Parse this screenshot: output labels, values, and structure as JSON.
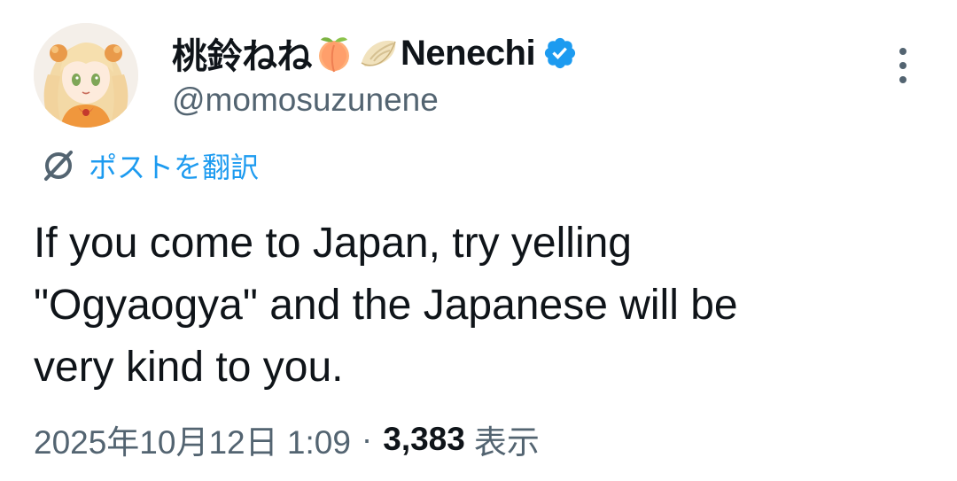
{
  "tweet": {
    "author": {
      "display_name": "桃鈴ねね",
      "display_name_suffix": "Nenechi",
      "name_emojis": [
        "peach-emoji",
        "dumpling-emoji"
      ],
      "verified_icon": "verified-badge-icon",
      "handle": "@momosuzunene",
      "avatar": "avatar-image"
    },
    "translate_label": "ポストを翻訳",
    "translate_icon": "translate-globe-icon",
    "more_icon": "more-vertical-icon",
    "text": "If you come to Japan, try yelling\n\"Ogyaogya\" and the Japanese will be\nvery kind to you.",
    "timestamp": "2025年10月12日 1:09",
    "separator": "·",
    "view_count": "3,383",
    "views_label": "表示"
  },
  "colors": {
    "text_primary": "#0f1419",
    "text_secondary": "#536471",
    "accent": "#1d9bf0"
  }
}
